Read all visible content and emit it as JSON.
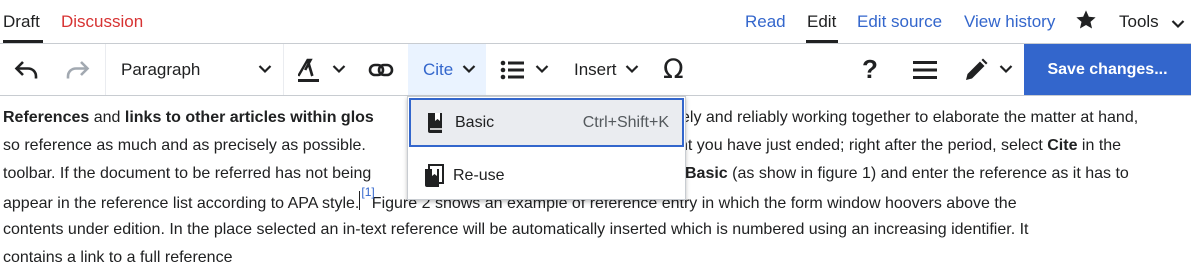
{
  "tabs": {
    "left": [
      {
        "label": "Draft",
        "color": "#202122",
        "active": true
      },
      {
        "label": "Discussion",
        "color": "#d73333"
      }
    ],
    "right": [
      {
        "label": "Read",
        "color": "#3366cc"
      },
      {
        "label": "Edit",
        "color": "#202122",
        "active": true
      },
      {
        "label": "Edit source",
        "color": "#3366cc"
      },
      {
        "label": "View history",
        "color": "#3366cc"
      }
    ],
    "watch_icon": "star-icon",
    "tools_label": "Tools"
  },
  "toolbar": {
    "undo_icon": "undo-icon",
    "redo_icon": "redo-icon",
    "format_label": "Paragraph",
    "text_style_icon": "text-style-icon",
    "link_icon": "link-icon",
    "cite_label": "Cite",
    "list_icon": "list-icon",
    "insert_label": "Insert",
    "special_char_icon": "omega-icon",
    "help_icon": "help-icon",
    "menu_icon": "hamburger-icon",
    "edit_mode_icon": "pencil-icon",
    "save_label": "Save changes..."
  },
  "cite_menu": {
    "items": [
      {
        "label": "Basic",
        "shortcut": "Ctrl+Shift+K",
        "icon": "book-icon",
        "selected": true
      },
      {
        "label": "Re-use",
        "icon": "book-reuse-icon"
      }
    ]
  },
  "content": {
    "l1_b1": "References",
    "l1_t1": " and ",
    "l1_b2": "links to other articles within glos",
    "l1_t2": "ely and reliably working together to elaborate the matter at hand,",
    "l2_t1": "so reference as much and as precisely as possible.",
    "l2_t2": "nt you have just ended; right after the period, select ",
    "l2_b1": "Cite",
    "l2_t3": " in the",
    "l3_t1": "toolbar. If the document to be referred has not being",
    "l3_b1": "Basic",
    "l3_t2": " (as show in figure 1) and enter the reference as it has to",
    "l4_t1": "appear in the reference list according to APA style.",
    "l4_ref": "[1]",
    "l4_t2": " Figure 2 shows an example of reference entry in which the form window hoovers above the",
    "l5": "contents under edition. In the place selected an in-text reference will be automatically inserted which is numbered using an increasing identifier. It",
    "l6": "contains a link to a full reference"
  },
  "colors": {
    "accent": "#3366cc",
    "link": "#3366cc",
    "new_link": "#d73333",
    "text": "#202122",
    "border": "#c8ccd1"
  }
}
